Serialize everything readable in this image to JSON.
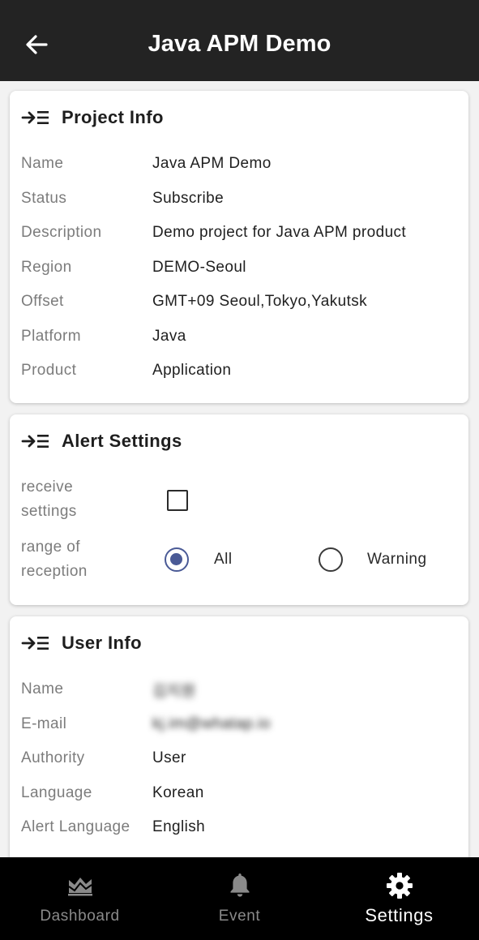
{
  "header": {
    "title": "Java APM Demo",
    "back_icon": "arrow-left-icon"
  },
  "project_info": {
    "title": "Project Info",
    "icon": "indent-list-icon",
    "rows": [
      {
        "label": "Name",
        "value": "Java APM Demo"
      },
      {
        "label": "Status",
        "value": "Subscribe"
      },
      {
        "label": "Description",
        "value": "Demo project for Java APM product"
      },
      {
        "label": "Region",
        "value": "DEMO-Seoul"
      },
      {
        "label": "Offset",
        "value": "GMT+09 Seoul,Tokyo,Yakutsk"
      },
      {
        "label": "Platform",
        "value": "Java"
      },
      {
        "label": "Product",
        "value": "Application"
      }
    ]
  },
  "alert_settings": {
    "title": "Alert Settings",
    "icon": "indent-list-icon",
    "receive_label": "receive\nsettings",
    "receive_checked": false,
    "range_label": "range of\nreception",
    "options": [
      {
        "label": "All",
        "selected": true
      },
      {
        "label": "Warning",
        "selected": false
      }
    ],
    "accent_color": "#4a5a96"
  },
  "user_info": {
    "title": "User Info",
    "icon": "indent-list-icon",
    "rows": [
      {
        "label": "Name",
        "value": "김지원",
        "obscured": true
      },
      {
        "label": "E-mail",
        "value": "kj.im@whatap.io",
        "obscured": true
      },
      {
        "label": "Authority",
        "value": "User"
      },
      {
        "label": "Language",
        "value": "Korean"
      },
      {
        "label": "Alert Language",
        "value": "English"
      }
    ]
  },
  "bottom_nav": {
    "items": [
      {
        "label": "Dashboard",
        "icon": "dashboard-icon",
        "active": false
      },
      {
        "label": "Event",
        "icon": "bell-icon",
        "active": false
      },
      {
        "label": "Settings",
        "icon": "gear-icon",
        "active": true
      }
    ]
  }
}
